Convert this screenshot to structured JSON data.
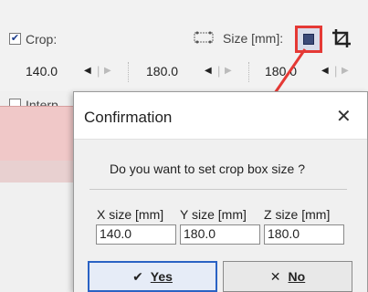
{
  "toolbar": {
    "crop_checked": "✔",
    "crop_label": "Crop:",
    "size_label": "Size [mm]:",
    "values": [
      "140.0",
      "180.0",
      "180.0"
    ],
    "interp_label": "Interp"
  },
  "dialog": {
    "title": "Confirmation",
    "question": "Do you want to set crop box size ?",
    "x_label": "X size [mm]",
    "y_label": "Y size [mm]",
    "z_label": "Z size [mm]",
    "x_value": "140.0",
    "y_value": "180.0",
    "z_value": "180.0",
    "yes_label": "Yes",
    "no_label": "No"
  },
  "colors": {
    "highlight": "#e53935",
    "yes_border": "#2a62c4"
  },
  "icons": [
    "check-icon",
    "grid-icon",
    "size-square-icon",
    "crop-icon",
    "arrow-left-icon",
    "arrow-right-icon",
    "close-icon",
    "checkmark-icon",
    "x-icon"
  ]
}
